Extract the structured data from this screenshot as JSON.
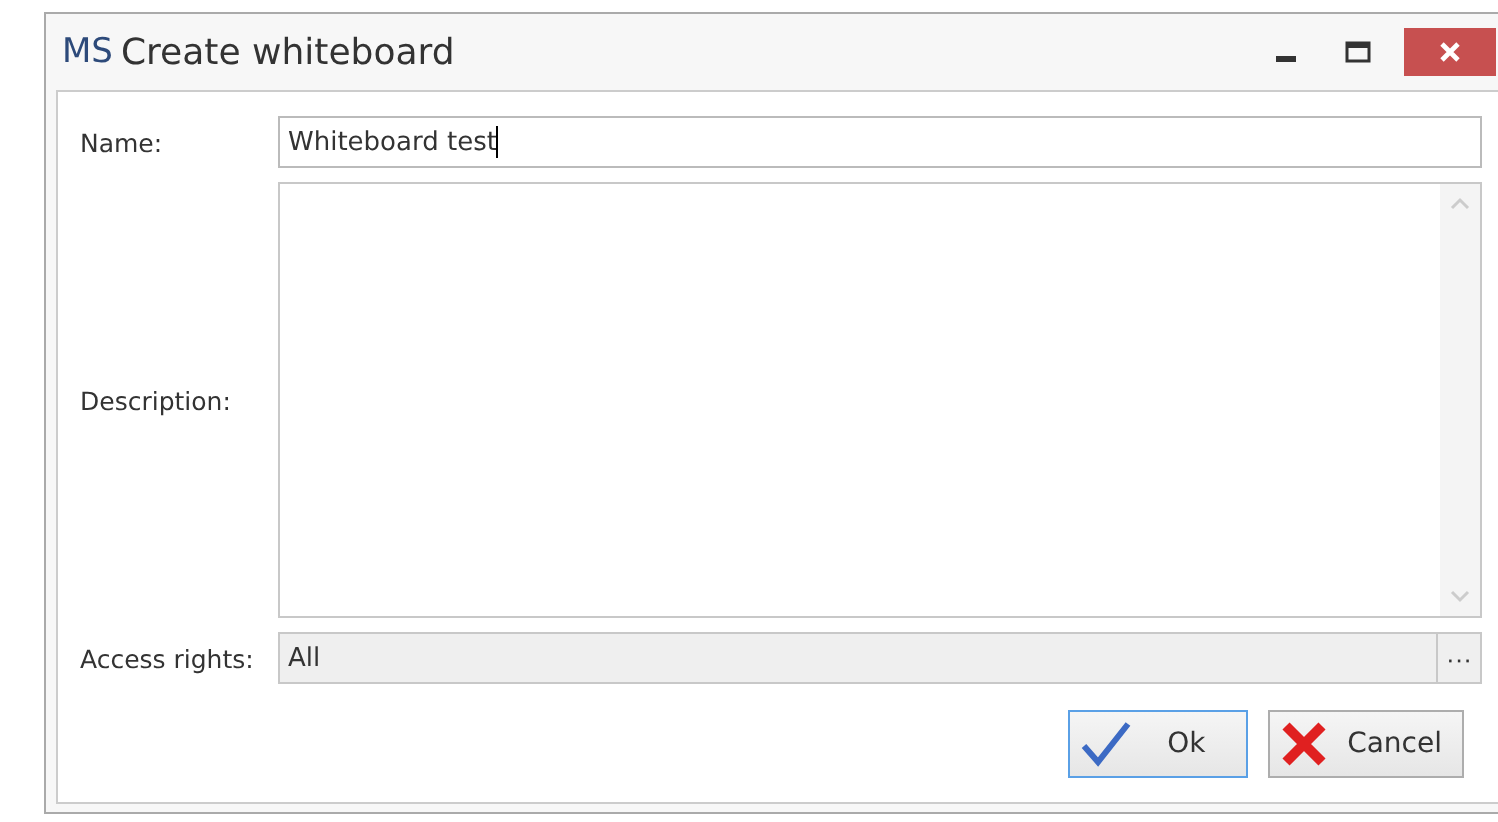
{
  "window": {
    "logo": "MS",
    "title": "Create whiteboard"
  },
  "form": {
    "name": {
      "label": "Name:",
      "value": "Whiteboard test",
      "focused": true
    },
    "description": {
      "label": "Description:"
    },
    "access_rights": {
      "label": "Access rights:",
      "value": "All",
      "button": "···"
    }
  },
  "buttons": [
    {
      "label": "Ok",
      "kind": "ok",
      "focused": true
    },
    {
      "label": "Cancel",
      "kind": "cancel",
      "focused": false
    }
  ]
}
